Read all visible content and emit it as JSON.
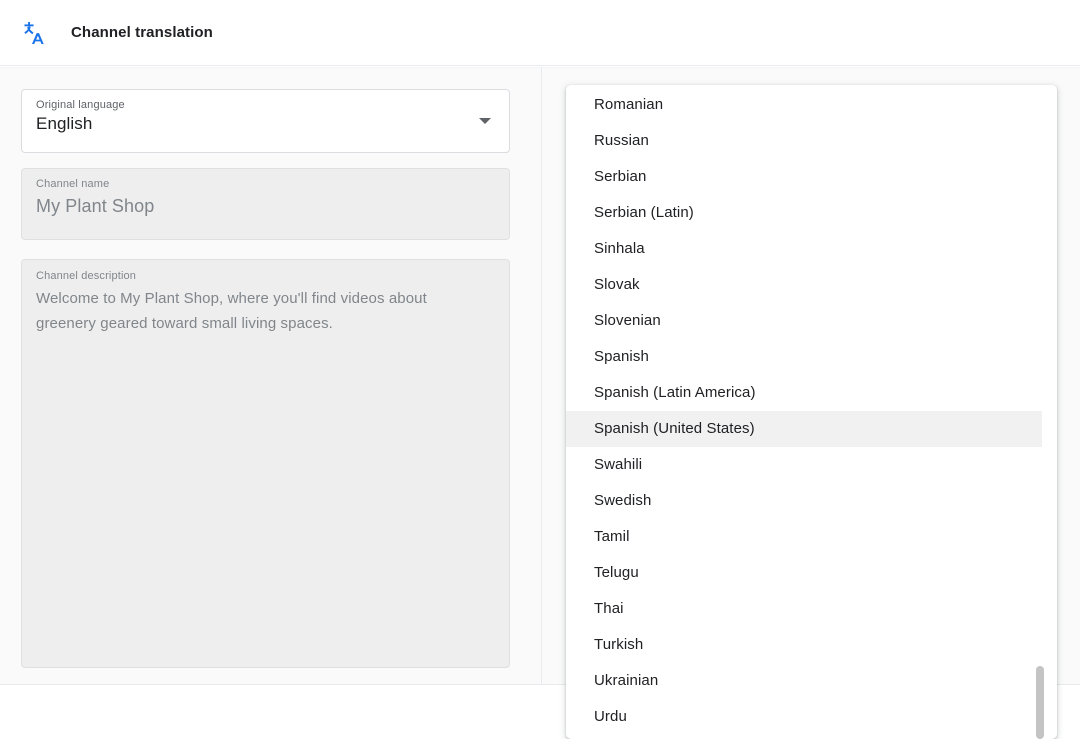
{
  "header": {
    "icon": "translate-icon",
    "title": "Channel translation"
  },
  "form": {
    "original_language": {
      "label": "Original language",
      "value": "English",
      "caret_icon": "chevron-down-icon",
      "disabled": false
    },
    "channel_name": {
      "label": "Channel name",
      "value": "My Plant Shop",
      "disabled": true
    },
    "channel_description": {
      "label": "Channel description",
      "value": "Welcome to My Plant Shop, where you'll find videos about greenery geared toward small living spaces.",
      "disabled": true
    }
  },
  "language_dropdown": {
    "highlighted": "Spanish (United States)",
    "items": [
      "Romanian",
      "Russian",
      "Serbian",
      "Serbian (Latin)",
      "Sinhala",
      "Slovak",
      "Slovenian",
      "Spanish",
      "Spanish (Latin America)",
      "Spanish (United States)",
      "Swahili",
      "Swedish",
      "Tamil",
      "Telugu",
      "Thai",
      "Turkish",
      "Ukrainian",
      "Urdu"
    ]
  },
  "colors": {
    "accent": "#1a73e8",
    "text_primary": "#202124",
    "text_secondary": "#5f6368",
    "text_disabled": "#80868b",
    "surface": "#ffffff",
    "background": "#fafafa",
    "border": "#e8eaed",
    "highlight": "#f1f1f1",
    "disabled_field": "#eeeeee",
    "scrollbar": "#c4c4c4"
  }
}
